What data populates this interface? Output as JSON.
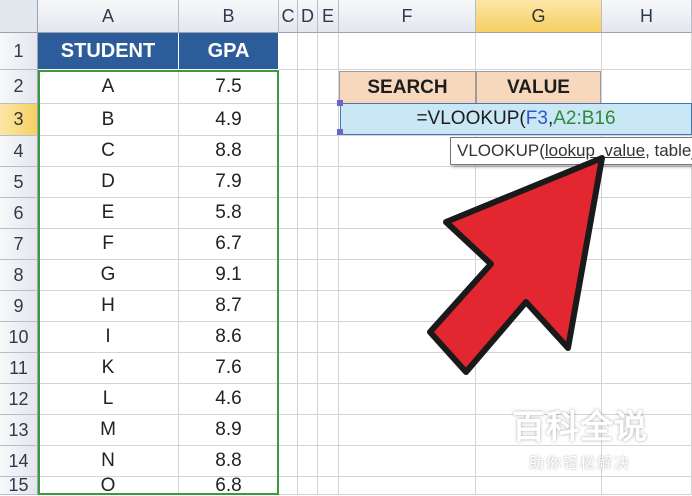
{
  "columns": [
    "A",
    "B",
    "C",
    "D",
    "E",
    "F",
    "G",
    "H"
  ],
  "selected_column": "G",
  "rows": [
    "1",
    "2",
    "3",
    "4",
    "5",
    "6",
    "7",
    "8",
    "9",
    "10",
    "11",
    "12",
    "13",
    "14",
    "15"
  ],
  "selected_row": "3",
  "table_headers": {
    "student": "STUDENT",
    "gpa": "GPA"
  },
  "students": [
    {
      "name": "A",
      "gpa": "7.5"
    },
    {
      "name": "B",
      "gpa": "4.9"
    },
    {
      "name": "C",
      "gpa": "8.8"
    },
    {
      "name": "D",
      "gpa": "7.9"
    },
    {
      "name": "E",
      "gpa": "5.8"
    },
    {
      "name": "F",
      "gpa": "6.7"
    },
    {
      "name": "G",
      "gpa": "9.1"
    },
    {
      "name": "H",
      "gpa": "8.7"
    },
    {
      "name": "I",
      "gpa": "8.6"
    },
    {
      "name": "K",
      "gpa": "7.6"
    },
    {
      "name": "L",
      "gpa": "4.6"
    },
    {
      "name": "M",
      "gpa": "8.9"
    },
    {
      "name": "N",
      "gpa": "8.8"
    },
    {
      "name": "O",
      "gpa": "6.8"
    }
  ],
  "lookup": {
    "search_label": "SEARCH",
    "value_label": "VALUE",
    "formula_prefix": "=VLOOKUP(",
    "formula_ref1": "F3",
    "formula_sep": ",",
    "formula_ref2": "A2:B16"
  },
  "tooltip": {
    "func": "VLOOKUP(",
    "arg1": "lookup_value",
    "rest": ", table_array, col_index_num, [range_lookup])"
  },
  "watermark": {
    "title": "百科全说",
    "subtitle": "助你轻松解决"
  },
  "colors": {
    "header_blue": "#2c5d9a",
    "label_tan": "#f8d8bd",
    "formula_cell": "#c9e7f4",
    "range_green": "#3b9a3b",
    "arrow_red": "#e32730"
  },
  "icons": {
    "arrow": "red-pointer-arrow-icon"
  }
}
